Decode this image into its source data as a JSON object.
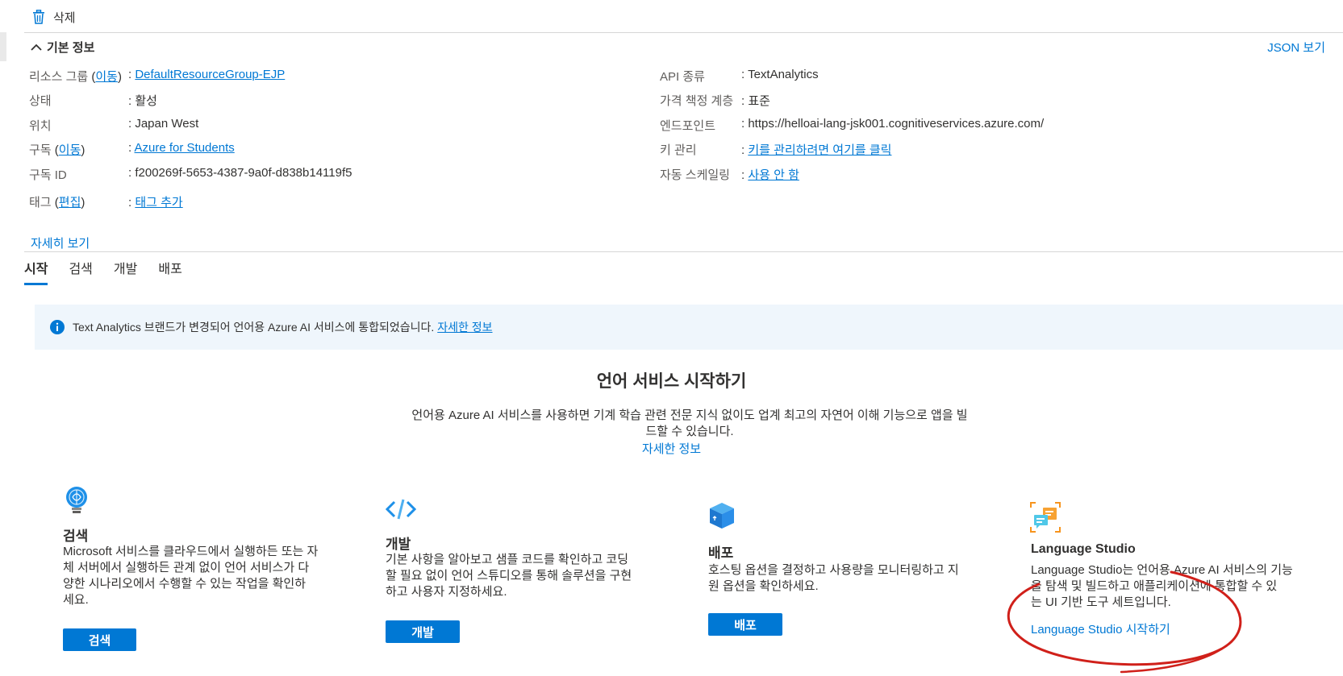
{
  "toolbar": {
    "delete_label": "삭제"
  },
  "essentials": {
    "title": "기본 정보",
    "json_view": "JSON 보기",
    "left": {
      "resource_group": {
        "label": "리소스 그룹",
        "move": "이동",
        "value": "DefaultResourceGroup-EJP"
      },
      "status": {
        "label": "상태",
        "value": "활성"
      },
      "location": {
        "label": "위치",
        "value": "Japan West"
      },
      "subscription": {
        "label": "구독",
        "move": "이동",
        "value": "Azure for Students"
      },
      "subscription_id": {
        "label": "구독 ID",
        "value": "f200269f-5653-4387-9a0f-d838b14119f5"
      },
      "tags": {
        "label": "태그",
        "edit": "편집",
        "value": "태그 추가"
      }
    },
    "right": {
      "api_kind": {
        "label": "API 종류",
        "value": "TextAnalytics"
      },
      "pricing_tier": {
        "label": "가격 책정 계층",
        "value": "표준"
      },
      "endpoint": {
        "label": "엔드포인트",
        "value": "https://helloai-lang-jsk001.cognitiveservices.azure.com/"
      },
      "key_mgmt": {
        "label": "키 관리",
        "value": "키를 관리하려면 여기를 클릭"
      },
      "autoscale": {
        "label": "자동 스케일링",
        "value": "사용 안 함"
      }
    },
    "see_more": "자세히 보기"
  },
  "tabs": [
    "시작",
    "검색",
    "개발",
    "배포"
  ],
  "banner": {
    "message": "Text Analytics 브랜드가 변경되어 언어용 Azure AI 서비스에 통합되었습니다.",
    "link": "자세한 정보"
  },
  "hero": {
    "title": "언어 서비스 시작하기",
    "desc_line1": "언어용 Azure AI 서비스를 사용하면 기계 학습 관련 전문 지식 없이도 업계 최고의 자연어 이해 기능으로 앱을 빌",
    "desc_line2": "드할 수 있습니다.",
    "link": "자세한 정보"
  },
  "cards": [
    {
      "title": "검색",
      "icon": "lightbulb-brain-icon",
      "desc": [
        "Microsoft 서비스를 클라우드에서 실행하든 또는 자",
        "체 서버에서 실행하든 관계 없이 언어 서비스가 다",
        "양한 시나리오에서 수행할 수 있는 작업을 확인하",
        "세요."
      ],
      "button": "검색"
    },
    {
      "title": "개발",
      "icon": "code-icon",
      "desc": [
        "기본 사항을 알아보고 샘플 코드를 확인하고 코딩",
        "할 필요 없이 언어 스튜디오를 통해 솔루션을 구현",
        "하고 사용자 지정하세요."
      ],
      "button": "개발"
    },
    {
      "title": "배포",
      "icon": "deploy-box-icon",
      "desc": [
        "호스팅 옵션을 결정하고 사용량을 모니터링하고 지",
        "원 옵션을 확인하세요."
      ],
      "button": "배포"
    },
    {
      "title": "Language Studio",
      "icon": "language-studio-icon",
      "desc": [
        "Language Studio는 언어용 Azure AI 서비스의 기능",
        "을 탐색 및 빌드하고 애플리케이션에 통합할 수 있",
        "는 UI 기반 도구 세트입니다."
      ],
      "link": "Language Studio 시작하기"
    }
  ],
  "colors": {
    "accent": "#0078d4",
    "banner_bg": "#eff6fc",
    "annotation": "#d0201a"
  }
}
